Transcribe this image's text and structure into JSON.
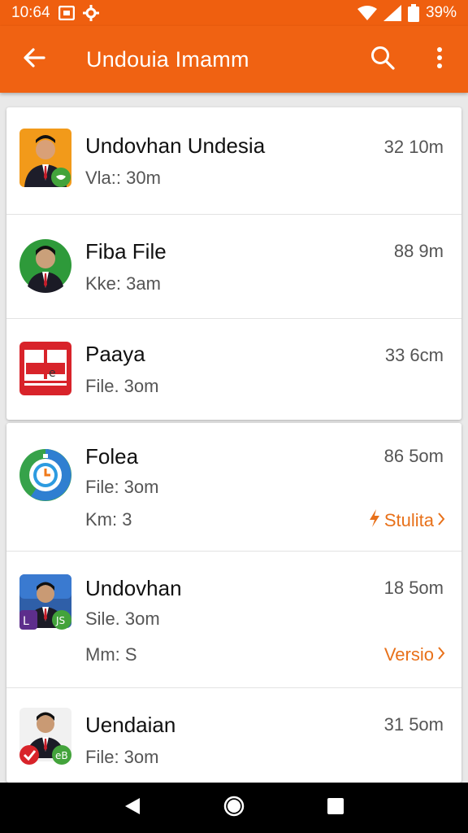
{
  "status_bar": {
    "time": "10:64",
    "battery_text": "39%",
    "icons": [
      "screenshot-icon",
      "settings-gear-icon",
      "wifi-icon",
      "signal-icon",
      "battery-icon"
    ]
  },
  "app_bar": {
    "title": "Undouia Imamm",
    "background_color": "#f06212",
    "icons": [
      "back-arrow-icon",
      "search-icon",
      "more-vert-icon"
    ]
  },
  "section1": {
    "items": [
      {
        "name": "Undovhan Undesia",
        "sub": "Vla:: 30m",
        "time": "32 10m",
        "icon": "portrait-app-icon"
      },
      {
        "name": "Fiba File",
        "sub": "Kke: 3am",
        "time": "88 9m",
        "icon": "portrait-round-icon"
      },
      {
        "name": "Paaya",
        "sub": "File. 3om",
        "time": "33 6cm",
        "icon": "red-document-icon"
      }
    ]
  },
  "section2": {
    "items": [
      {
        "name": "Folea",
        "sub": "File: 3om",
        "sub2": "Km: 3",
        "time": "86 5om",
        "link": "Stulita",
        "icon": "clock-app-icon"
      },
      {
        "name": "Undovhan",
        "sub": "Sile. 3om",
        "sub2": "Mm: S",
        "time": "18 5om",
        "link": "Versio",
        "icon": "portrait-badge-icon"
      },
      {
        "name": "Uendaian",
        "sub": "File: 3om",
        "time": "31 5om",
        "icon": "portrait-check-icon"
      }
    ]
  },
  "accent_color": "#e8711a",
  "nav_bar": {
    "icons": [
      "nav-back-icon",
      "nav-home-icon",
      "nav-recents-icon"
    ]
  }
}
